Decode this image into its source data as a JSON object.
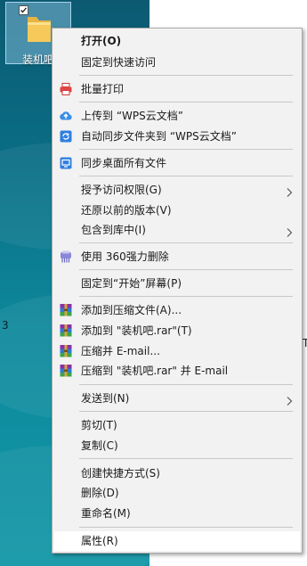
{
  "desktop": {
    "icon_label": "装机吧",
    "edge_glyphs": [
      "3",
      "T"
    ]
  },
  "context_menu": {
    "items": [
      {
        "label": "打开(O)",
        "icon": "none",
        "submenu": false,
        "bold": true
      },
      {
        "label": "固定到快速访问",
        "icon": "none",
        "submenu": false
      },
      {
        "label": "批量打印",
        "icon": "printer-icon",
        "submenu": false
      },
      {
        "label": "上传到 “WPS云文档”",
        "icon": "cloud-upload-icon",
        "submenu": false
      },
      {
        "label": "自动同步文件夹到 “WPS云文档”",
        "icon": "sync-folder-icon",
        "submenu": false
      },
      {
        "label": "同步桌面所有文件",
        "icon": "desktop-sync-icon",
        "submenu": false
      },
      {
        "label": "授予访问权限(G)",
        "icon": "none",
        "submenu": true
      },
      {
        "label": "还原以前的版本(V)",
        "icon": "none",
        "submenu": false
      },
      {
        "label": "包含到库中(I)",
        "icon": "none",
        "submenu": true
      },
      {
        "label": "使用 360强力删除",
        "icon": "shredder-icon",
        "submenu": false
      },
      {
        "label": "固定到“开始”屏幕(P)",
        "icon": "none",
        "submenu": false
      },
      {
        "label": "添加到压缩文件(A)...",
        "icon": "winrar-icon",
        "submenu": false
      },
      {
        "label": "添加到 \"装机吧.rar\"(T)",
        "icon": "winrar-icon",
        "submenu": false
      },
      {
        "label": "压缩并 E-mail...",
        "icon": "winrar-icon",
        "submenu": false
      },
      {
        "label": "压缩到 \"装机吧.rar\" 并 E-mail",
        "icon": "winrar-icon",
        "submenu": false
      },
      {
        "label": "发送到(N)",
        "icon": "none",
        "submenu": true
      },
      {
        "label": "剪切(T)",
        "icon": "none",
        "submenu": false
      },
      {
        "label": "复制(C)",
        "icon": "none",
        "submenu": false
      },
      {
        "label": "创建快捷方式(S)",
        "icon": "none",
        "submenu": false
      },
      {
        "label": "删除(D)",
        "icon": "none",
        "submenu": false
      },
      {
        "label": "重命名(M)",
        "icon": "none",
        "submenu": false
      },
      {
        "label": "属性(R)",
        "icon": "none",
        "submenu": false,
        "highlighted": true
      }
    ]
  },
  "colors": {
    "menu_background": "#f2f2f2",
    "highlight": "#ffffff",
    "separator": "#c8c8c8",
    "desktop_teal": "#0e8a9d"
  }
}
